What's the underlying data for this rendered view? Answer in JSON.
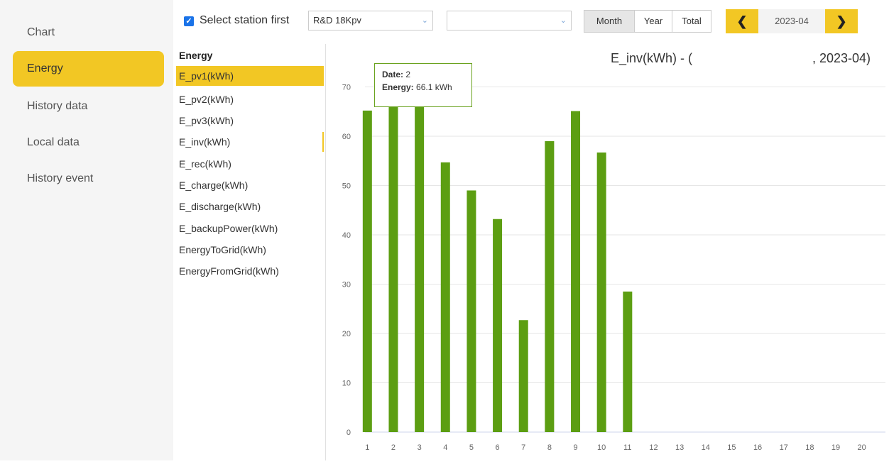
{
  "sidebar": {
    "items": [
      {
        "label": "Chart",
        "active": false
      },
      {
        "label": "Energy",
        "active": true
      },
      {
        "label": "History data",
        "active": false
      },
      {
        "label": "Local data",
        "active": false
      },
      {
        "label": "History event",
        "active": false
      }
    ]
  },
  "toolbar": {
    "select_station_label": "Select station first",
    "station_value": "R&D 18Kpv",
    "device_value": "",
    "period_tabs": [
      {
        "label": "Month",
        "active": true
      },
      {
        "label": "Year",
        "active": false
      },
      {
        "label": "Total",
        "active": false
      }
    ],
    "prev_icon": "chevron-left-icon",
    "next_icon": "chevron-right-icon",
    "date_value": "2023-04"
  },
  "energy_list": {
    "heading": "Energy",
    "items": [
      "E_pv1(kWh)",
      "E_pv2(kWh)",
      "E_pv3(kWh)",
      "E_inv(kWh)",
      "E_rec(kWh)",
      "E_charge(kWh)",
      "E_discharge(kWh)",
      "E_backupPower(kWh)",
      "EnergyToGrid(kWh)",
      "EnergyFromGrid(kWh)"
    ],
    "active_index": 0
  },
  "chart": {
    "title_left": "E_inv(kWh) - (",
    "title_right": ", 2023-04)",
    "tooltip": {
      "date_label": "Date:",
      "date_value": "2",
      "energy_label": "Energy:",
      "energy_value": "66.1 kWh"
    }
  },
  "colors": {
    "accent": "#f2c724",
    "bar": "#5c9e12",
    "checkbox": "#1a73e8"
  },
  "chart_data": {
    "type": "bar",
    "categories": [
      "1",
      "2",
      "3",
      "4",
      "5",
      "6",
      "7",
      "8",
      "9",
      "10",
      "11",
      "12",
      "13",
      "14",
      "15",
      "16",
      "17",
      "18",
      "19",
      "20"
    ],
    "values": [
      65.2,
      66.1,
      66.8,
      54.7,
      49.0,
      43.2,
      22.7,
      59.0,
      65.1,
      56.7,
      28.5,
      0,
      0,
      0,
      0,
      0,
      0,
      0,
      0,
      0
    ],
    "yticks": [
      0,
      10,
      20,
      30,
      40,
      50,
      60,
      70
    ],
    "ylim": [
      0,
      75
    ],
    "grid": true
  }
}
